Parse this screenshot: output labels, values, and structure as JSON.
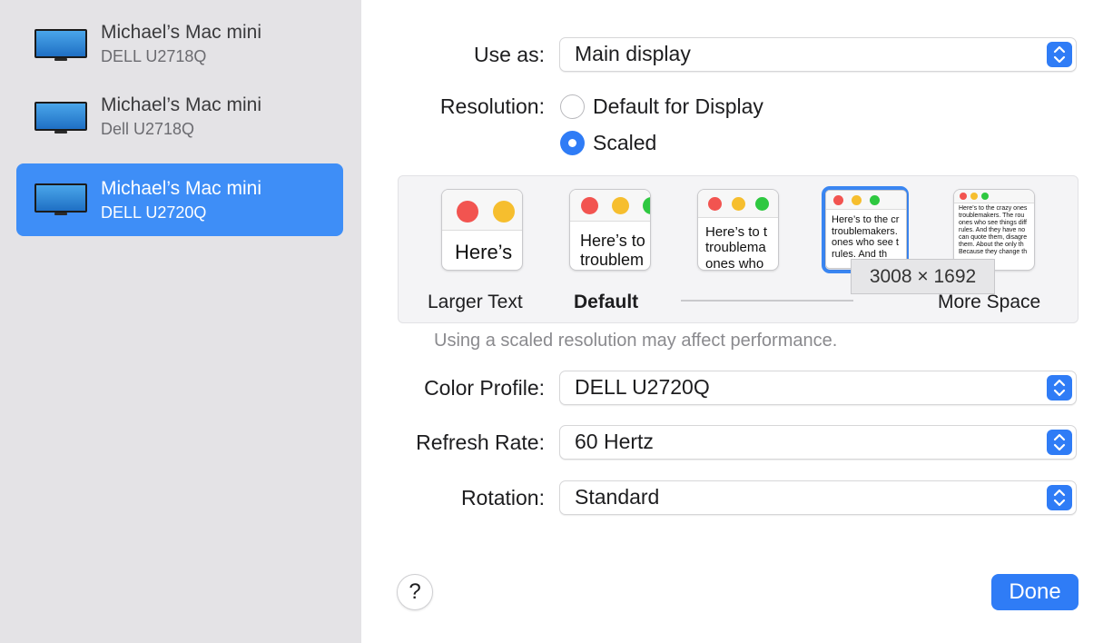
{
  "sidebar": {
    "displays": [
      {
        "name": "Michael’s Mac mini",
        "model": "DELL U2718Q",
        "selected": false
      },
      {
        "name": "Michael’s Mac mini",
        "model": "Dell U2718Q",
        "selected": false
      },
      {
        "name": "Michael’s Mac mini",
        "model": "DELL U2720Q",
        "selected": true
      }
    ]
  },
  "settings": {
    "use_as": {
      "label": "Use as:",
      "value": "Main display"
    },
    "resolution": {
      "label": "Resolution:",
      "options": [
        "Default for Display",
        "Scaled"
      ],
      "selected": "Scaled"
    },
    "scaled": {
      "thumbnails": [
        {
          "text": "Here’s"
        },
        {
          "text": "Here’s to t\ntroublem"
        },
        {
          "text": "Here’s to t\ntroublema\nones who"
        },
        {
          "text": "Here’s to the cr\ntroublemakers.\nones who see t\nrules. And th"
        },
        {
          "text": "Here’s to the crazy ones\ntroublemakers. The rou\nones who see things diff\nrules. And they have no\ncan quote them, disagre\nthem. About the only th\nBecause they change th"
        }
      ],
      "selected_index": 3,
      "left_label": "Larger Text",
      "default_label": "Default",
      "right_label": "More Space",
      "tooltip": "3008 × 1692"
    },
    "performance_note": "Using a scaled resolution may affect performance.",
    "color_profile": {
      "label": "Color Profile:",
      "value": "DELL U2720Q"
    },
    "refresh_rate": {
      "label": "Refresh Rate:",
      "value": "60 Hertz"
    },
    "rotation": {
      "label": "Rotation:",
      "value": "Standard"
    }
  },
  "footer": {
    "help_label": "?",
    "done_label": "Done"
  },
  "colors": {
    "accent": "#2f7cf6",
    "sidebar_bg": "#e4e3e6",
    "selected_row": "#3e8ef7"
  }
}
